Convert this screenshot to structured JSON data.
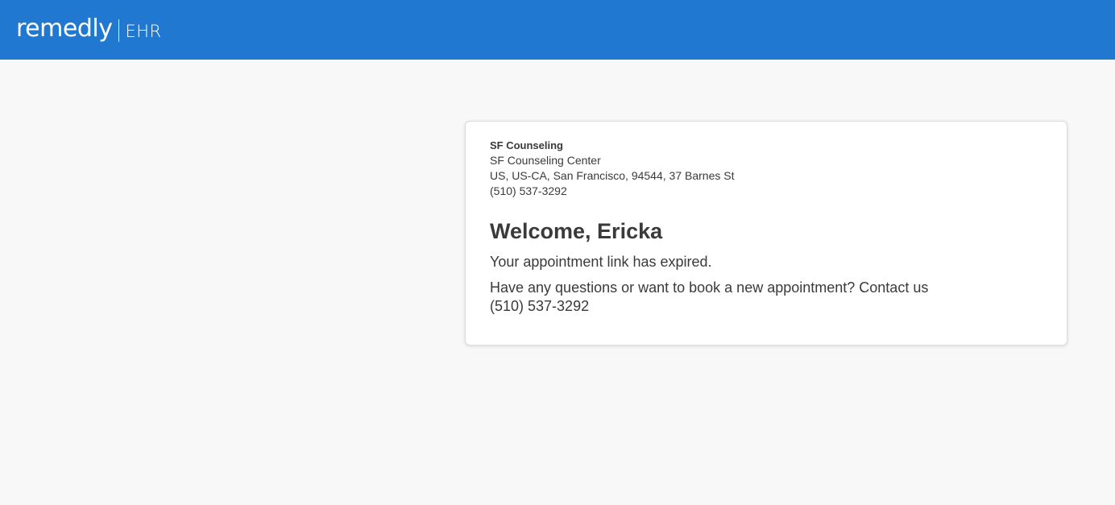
{
  "brand": {
    "name": "remedly",
    "suffix": "EHR"
  },
  "practice": {
    "name": "SF Counseling",
    "center": "SF Counseling Center",
    "address": "US, US-CA, San Francisco, 94544, 37 Barnes St",
    "phone": "(510) 537-3292"
  },
  "main": {
    "welcome": "Welcome, Ericka",
    "expired_message": "Your appointment link has expired.",
    "contact_prompt": "Have any questions or want to book a new appointment? Contact us",
    "contact_phone": "(510) 537-3292"
  },
  "colors": {
    "header_bg": "#2178d1",
    "page_bg": "#f8f8f8",
    "card_bg": "#ffffff",
    "text": "#3a3a3a"
  }
}
